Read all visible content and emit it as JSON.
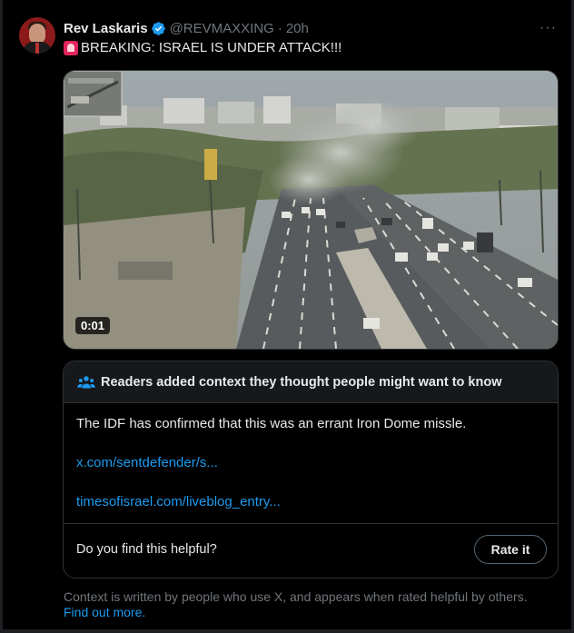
{
  "tweet": {
    "author_name": "Rev Laskaris",
    "handle": "@REVMAXXING",
    "separator": "·",
    "time": "20h",
    "text": "BREAKING: ISRAEL IS UNDER ATTACK!!!",
    "more_glyph": "···"
  },
  "media": {
    "duration": "0:01"
  },
  "community_note": {
    "header": "Readers added context they thought people might want to know",
    "body": "The IDF has confirmed that this was an errant Iron Dome missle.",
    "links": [
      "x.com/sentdefender/s...",
      "timesofisrael.com/liveblog_entry..."
    ],
    "helpful_question": "Do you find this helpful?",
    "rate_button": "Rate it"
  },
  "footer": {
    "context_text": "Context is written by people who use X, and appears when rated helpful by others.",
    "find_out_more": "Find out more."
  },
  "colors": {
    "background": "#000000",
    "text_primary": "#e7e9ea",
    "text_secondary": "#71767b",
    "link": "#1d9bf0",
    "verified": "#1d9bf0",
    "border": "#2f3336"
  }
}
